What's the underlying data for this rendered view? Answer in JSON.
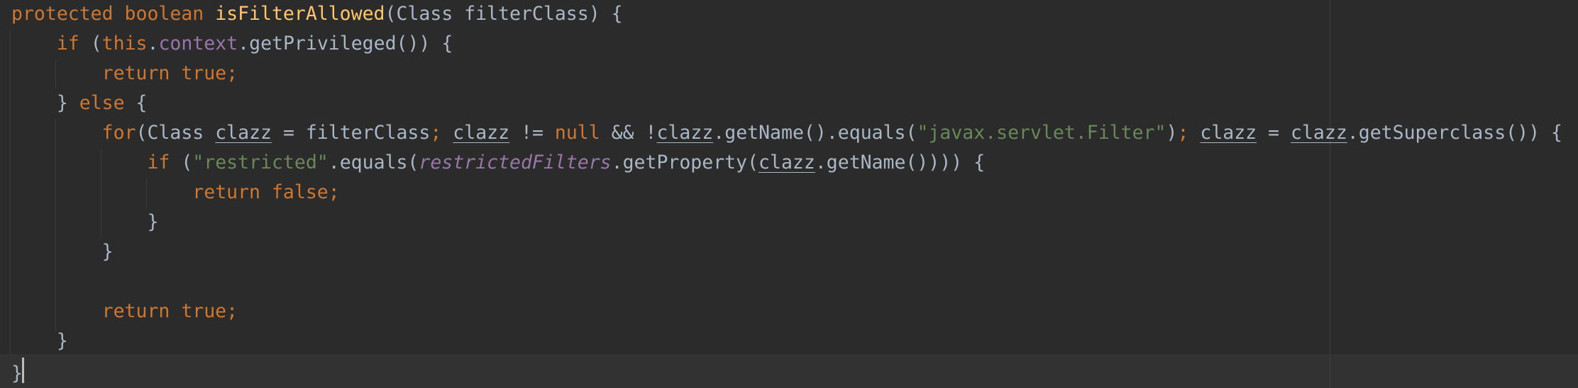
{
  "editor": {
    "lines": [
      [
        {
          "t": "protected boolean ",
          "c": "kw"
        },
        {
          "t": "isFilterAllowed",
          "c": "fn"
        },
        {
          "t": "(Class filterClass) {",
          "c": ""
        }
      ],
      [
        {
          "t": "    ",
          "c": ""
        },
        {
          "t": "if ",
          "c": "kw"
        },
        {
          "t": "(",
          "c": ""
        },
        {
          "t": "this",
          "c": "kw"
        },
        {
          "t": ".",
          "c": ""
        },
        {
          "t": "context",
          "c": "field"
        },
        {
          "t": ".getPrivileged()) {",
          "c": ""
        }
      ],
      [
        {
          "t": "        ",
          "c": ""
        },
        {
          "t": "return true;",
          "c": "kw"
        }
      ],
      [
        {
          "t": "    } ",
          "c": ""
        },
        {
          "t": "else ",
          "c": "kw"
        },
        {
          "t": "{",
          "c": ""
        }
      ],
      [
        {
          "t": "        ",
          "c": ""
        },
        {
          "t": "for",
          "c": "kw"
        },
        {
          "t": "(Class ",
          "c": ""
        },
        {
          "t": "clazz",
          "c": "var"
        },
        {
          "t": " = filterClass",
          "c": ""
        },
        {
          "t": "; ",
          "c": "kw"
        },
        {
          "t": "clazz",
          "c": "var"
        },
        {
          "t": " != ",
          "c": ""
        },
        {
          "t": "null ",
          "c": "kw"
        },
        {
          "t": "&& !",
          "c": ""
        },
        {
          "t": "clazz",
          "c": "var"
        },
        {
          "t": ".getName().equals(",
          "c": ""
        },
        {
          "t": "\"javax.servlet.Filter\"",
          "c": "str"
        },
        {
          "t": ")",
          "c": ""
        },
        {
          "t": "; ",
          "c": "kw"
        },
        {
          "t": "clazz",
          "c": "var"
        },
        {
          "t": " = ",
          "c": ""
        },
        {
          "t": "clazz",
          "c": "var"
        },
        {
          "t": ".getSuperclass()) {",
          "c": ""
        }
      ],
      [
        {
          "t": "            ",
          "c": ""
        },
        {
          "t": "if ",
          "c": "kw"
        },
        {
          "t": "(",
          "c": ""
        },
        {
          "t": "\"restricted\"",
          "c": "str"
        },
        {
          "t": ".equals(",
          "c": ""
        },
        {
          "t": "restrictedFilters",
          "c": "sfield"
        },
        {
          "t": ".getProperty(",
          "c": ""
        },
        {
          "t": "clazz",
          "c": "var"
        },
        {
          "t": ".getName()))) {",
          "c": ""
        }
      ],
      [
        {
          "t": "                ",
          "c": ""
        },
        {
          "t": "return false;",
          "c": "kw"
        }
      ],
      [
        {
          "t": "            }",
          "c": ""
        }
      ],
      [
        {
          "t": "        }",
          "c": ""
        }
      ],
      [
        {
          "t": "",
          "c": ""
        }
      ],
      [
        {
          "t": "        ",
          "c": ""
        },
        {
          "t": "return true;",
          "c": "kw"
        }
      ],
      [
        {
          "t": "    }",
          "c": ""
        }
      ],
      [
        {
          "t": "}",
          "c": "brace-hl"
        }
      ]
    ]
  },
  "colors": {
    "background": "#2b2b2b",
    "keyword": "#cc7832",
    "method": "#ffc66d",
    "field": "#9876aa",
    "string": "#6a8759",
    "default_text": "#a9b7c6"
  }
}
